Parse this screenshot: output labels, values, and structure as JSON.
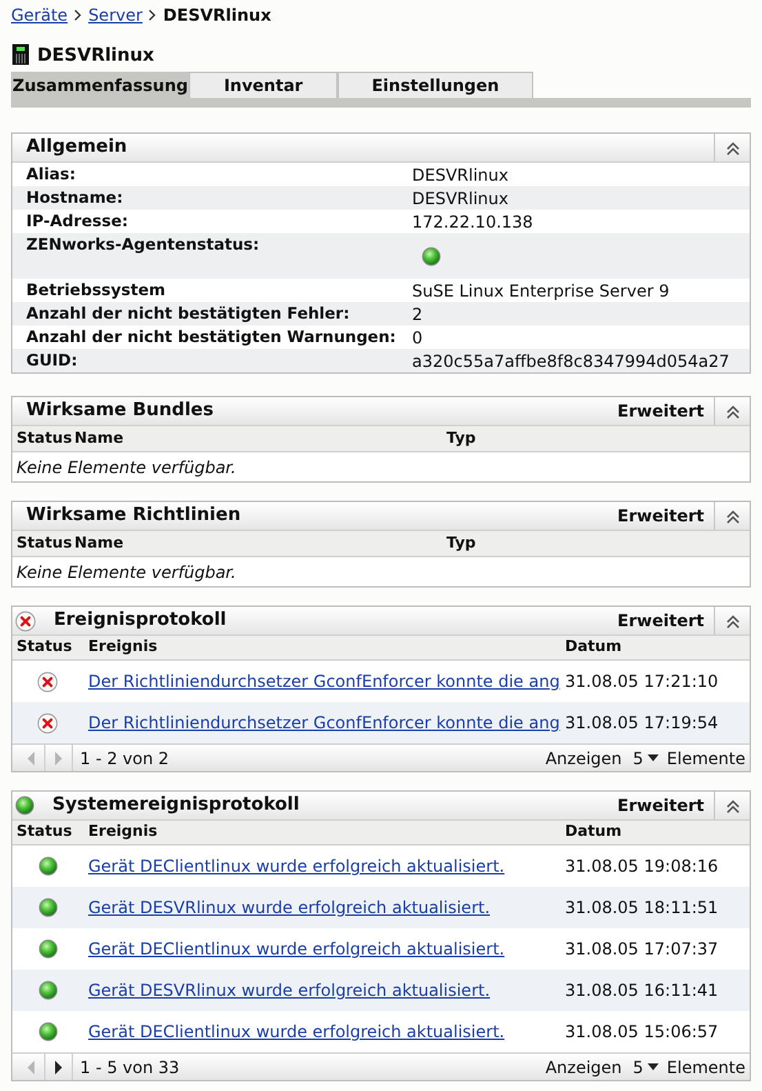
{
  "breadcrumb": [
    {
      "label": "Geräte",
      "kind": "link"
    },
    {
      "label": "Server",
      "kind": "link"
    },
    {
      "label": "DESVRlinux",
      "kind": "current"
    }
  ],
  "title": "DESVRlinux",
  "tabs": [
    {
      "label": "Zusammenfassung",
      "selected": true
    },
    {
      "label": "Inventar",
      "selected": false
    },
    {
      "label": "Einstellungen",
      "selected": false
    }
  ],
  "general": {
    "title": "Allgemein",
    "rows": [
      {
        "label": "Alias:",
        "kind": "text",
        "value": "DESVRlinux"
      },
      {
        "label": "Hostname:",
        "kind": "text",
        "value": "DESVRlinux"
      },
      {
        "label": "IP-Adresse:",
        "kind": "text",
        "value": "172.22.10.138"
      },
      {
        "label": "ZENworks-Agentenstatus:",
        "kind": "status",
        "ok": true
      },
      {
        "label": "Betriebssystem",
        "kind": "text",
        "value": "SuSE Linux Enterprise Server 9"
      },
      {
        "label": "Anzahl der nicht bestätigten Fehler:",
        "kind": "text",
        "value": "2"
      },
      {
        "label": "Anzahl der nicht bestätigten Warnungen:",
        "kind": "text",
        "value": "0"
      },
      {
        "label": "GUID:",
        "kind": "text",
        "value": "a320c55a7affbe8f8c8347994d054a27"
      }
    ]
  },
  "panels": [
    {
      "kind": "empty",
      "title": "Wirksame Bundles",
      "action": "Erweitert",
      "columns": [
        "Status",
        "Name",
        "Typ"
      ],
      "empty_text": "Keine Elemente verfügbar."
    },
    {
      "kind": "empty",
      "title": "Wirksame Richtlinien",
      "action": "Erweitert",
      "columns": [
        "Status",
        "Name",
        "Typ"
      ],
      "empty_text": "Keine Elemente verfügbar."
    },
    {
      "kind": "events",
      "title": "Ereignisprotokoll",
      "ok": false,
      "action": "Erweitert",
      "columns": [
        "Status",
        "Ereignis",
        "Datum"
      ],
      "rows": [
        {
          "ok": false,
          "event": "Der Richtliniendurchsetzer GconfEnforcer konnte die ang",
          "date": "31.08.05 17:21:10"
        },
        {
          "ok": false,
          "event": "Der Richtliniendurchsetzer GconfEnforcer konnte die ang",
          "date": "31.08.05 17:19:54"
        }
      ],
      "pager": {
        "prev_disabled": true,
        "next_disabled": true,
        "range": "1 - 2 von 2",
        "show_label": "Anzeigen",
        "page_size": "5",
        "items_label": "Elemente"
      }
    },
    {
      "kind": "events",
      "title": "Systemereignisprotokoll",
      "ok": true,
      "action": "Erweitert",
      "columns": [
        "Status",
        "Ereignis",
        "Datum"
      ],
      "rows": [
        {
          "ok": true,
          "event": "Gerät DEClientlinux wurde erfolgreich aktualisiert.",
          "date": "31.08.05 19:08:16"
        },
        {
          "ok": true,
          "event": "Gerät DESVRlinux wurde erfolgreich aktualisiert.",
          "date": "31.08.05 18:11:51"
        },
        {
          "ok": true,
          "event": "Gerät DEClientlinux wurde erfolgreich aktualisiert.",
          "date": "31.08.05 17:07:37"
        },
        {
          "ok": true,
          "event": "Gerät DESVRlinux wurde erfolgreich aktualisiert.",
          "date": "31.08.05 16:11:41"
        },
        {
          "ok": true,
          "event": "Gerät DEClientlinux wurde erfolgreich aktualisiert.",
          "date": "31.08.05 15:06:57"
        }
      ],
      "pager": {
        "prev_disabled": true,
        "next_disabled": false,
        "range": "1 - 5 von 33",
        "show_label": "Anzeigen",
        "page_size": "5",
        "items_label": "Elemente"
      }
    }
  ]
}
